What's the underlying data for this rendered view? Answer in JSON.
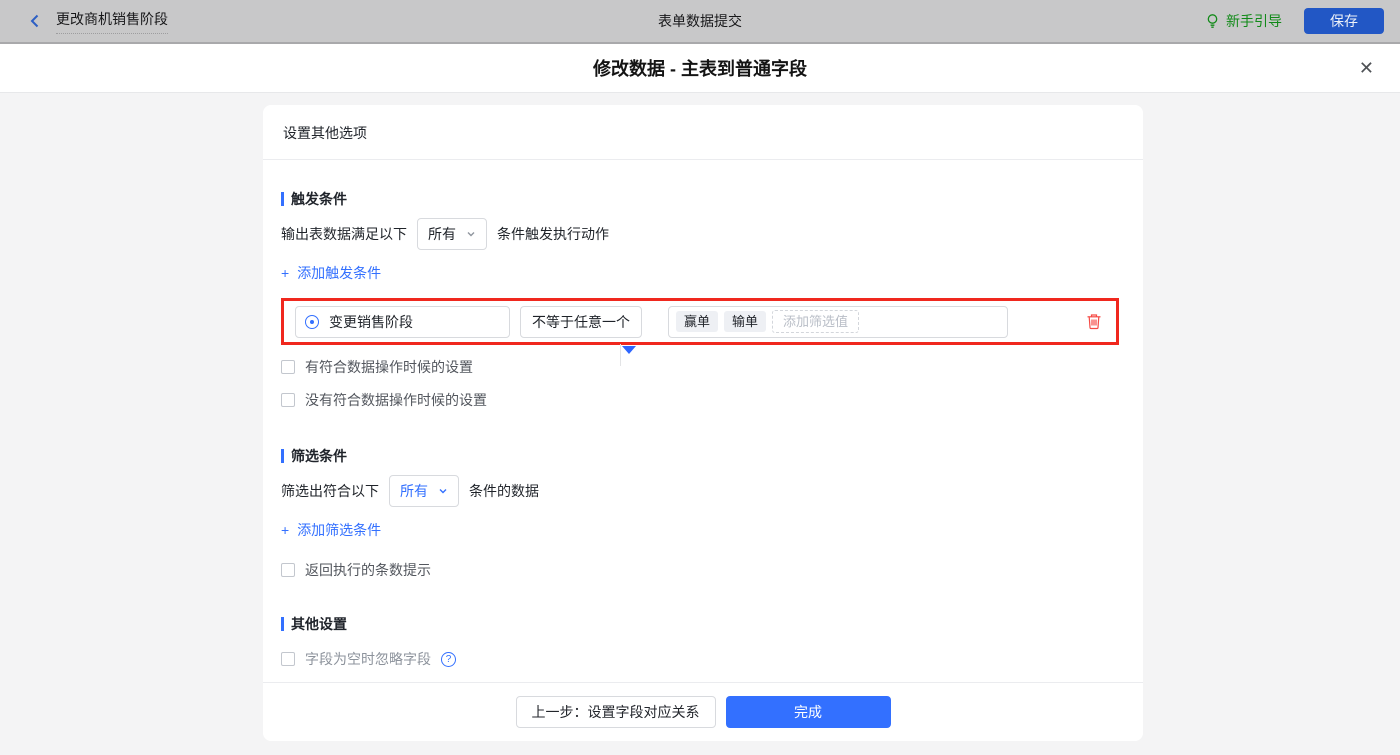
{
  "topbar": {
    "back_label": "更改商机销售阶段",
    "title": "表单数据提交",
    "guide_label": "新手引导",
    "save_label": "保存"
  },
  "dialog": {
    "title": "修改数据 - 主表到普通字段",
    "close_glyph": "✕"
  },
  "panel": {
    "header": "设置其他选项"
  },
  "trigger": {
    "section_title": "触发条件",
    "sentence_prefix": "输出表数据满足以下",
    "match_value": "所有",
    "sentence_suffix": "条件触发执行动作",
    "add_plus": "+",
    "add_label": "添加触发条件",
    "condition": {
      "field_label": "变更销售阶段",
      "operator_label": "不等于任意一个",
      "values": [
        "赢单",
        "输单"
      ],
      "add_value_placeholder": "添加筛选值"
    },
    "checkbox_has_match": "有符合数据操作时候的设置",
    "checkbox_no_match": "没有符合数据操作时候的设置"
  },
  "filter": {
    "section_title": "筛选条件",
    "sentence_prefix": "筛选出符合以下",
    "match_value": "所有",
    "sentence_suffix": "条件的数据",
    "add_plus": "+",
    "add_label": "添加筛选条件",
    "checkbox_count_tip": "返回执行的条数提示"
  },
  "other": {
    "section_title": "其他设置",
    "checkbox_ignore_empty": "字段为空时忽略字段",
    "help_glyph": "?"
  },
  "footer": {
    "prev_label": "上一步：设置字段对应关系",
    "done_label": "完成"
  },
  "colors": {
    "accent_blue": "#3370ff",
    "highlight_red": "#f0281e",
    "guide_green": "#118a18",
    "topbar_gray": "#c8c8c9",
    "trash_red": "#f54a45"
  }
}
